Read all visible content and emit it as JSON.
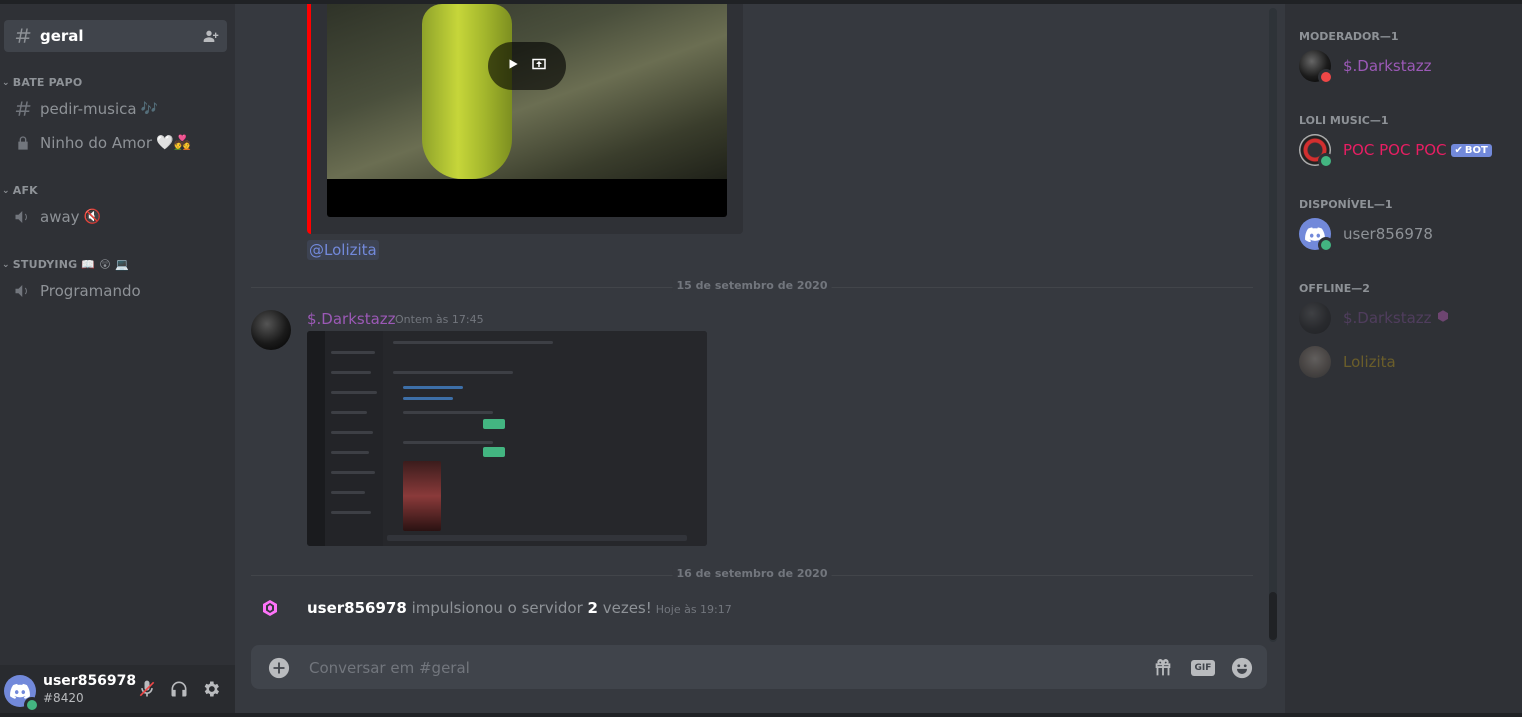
{
  "sidebar": {
    "active_channel": "geral",
    "categories": [
      {
        "name": "BATE PAPO"
      },
      {
        "name": "AFK"
      },
      {
        "name": "STUDYING",
        "emojis": "📖 😲 💻"
      }
    ],
    "channels": [
      {
        "name": "pedir-musica",
        "emoji": "🎶"
      },
      {
        "name": "Ninho do Amor",
        "emoji": "🤍💑"
      },
      {
        "name": "away",
        "emoji": "🔇"
      },
      {
        "name": "Programando"
      }
    ],
    "user": {
      "name": "user856978",
      "tag": "#8420"
    }
  },
  "chat": {
    "mention": "@Lolizita",
    "dividers": [
      "15 de setembro de 2020",
      "16 de setembro de 2020"
    ],
    "message": {
      "author": "$.Darkstazz",
      "timestamp": "Ontem às 17:45"
    },
    "boost": {
      "user": "user856978",
      "text_before": " impulsionou o servidor ",
      "count": "2",
      "text_after": " vezes!",
      "timestamp": "Hoje às 19:17"
    },
    "composer_placeholder": "Conversar em #geral",
    "gif_label": "GIF"
  },
  "members": {
    "groups": [
      {
        "title": "MODERADOR—1",
        "members": [
          {
            "name": "$.Darkstazz",
            "color": "#9b59b6",
            "status": "dnd"
          }
        ]
      },
      {
        "title": "LOLI MUSIC—1",
        "members": [
          {
            "name": "POC POC POC",
            "color": "#e91e63",
            "status": "online",
            "badge": "BOT"
          }
        ]
      },
      {
        "title": "DISPONÍVEL—1",
        "members": [
          {
            "name": "user856978",
            "color": "#8e9297",
            "status": "online"
          }
        ]
      },
      {
        "title": "OFFLINE—2",
        "members": [
          {
            "name": "$.Darkstazz",
            "color": "#9b59b6",
            "status": "offline"
          },
          {
            "name": "Lolizita",
            "color": "#f1c40f",
            "status": "offline"
          }
        ]
      }
    ]
  },
  "colors": {
    "accent": "#7289da",
    "online": "#43b581",
    "dnd": "#f04747",
    "embed_border": "#ff0000"
  }
}
